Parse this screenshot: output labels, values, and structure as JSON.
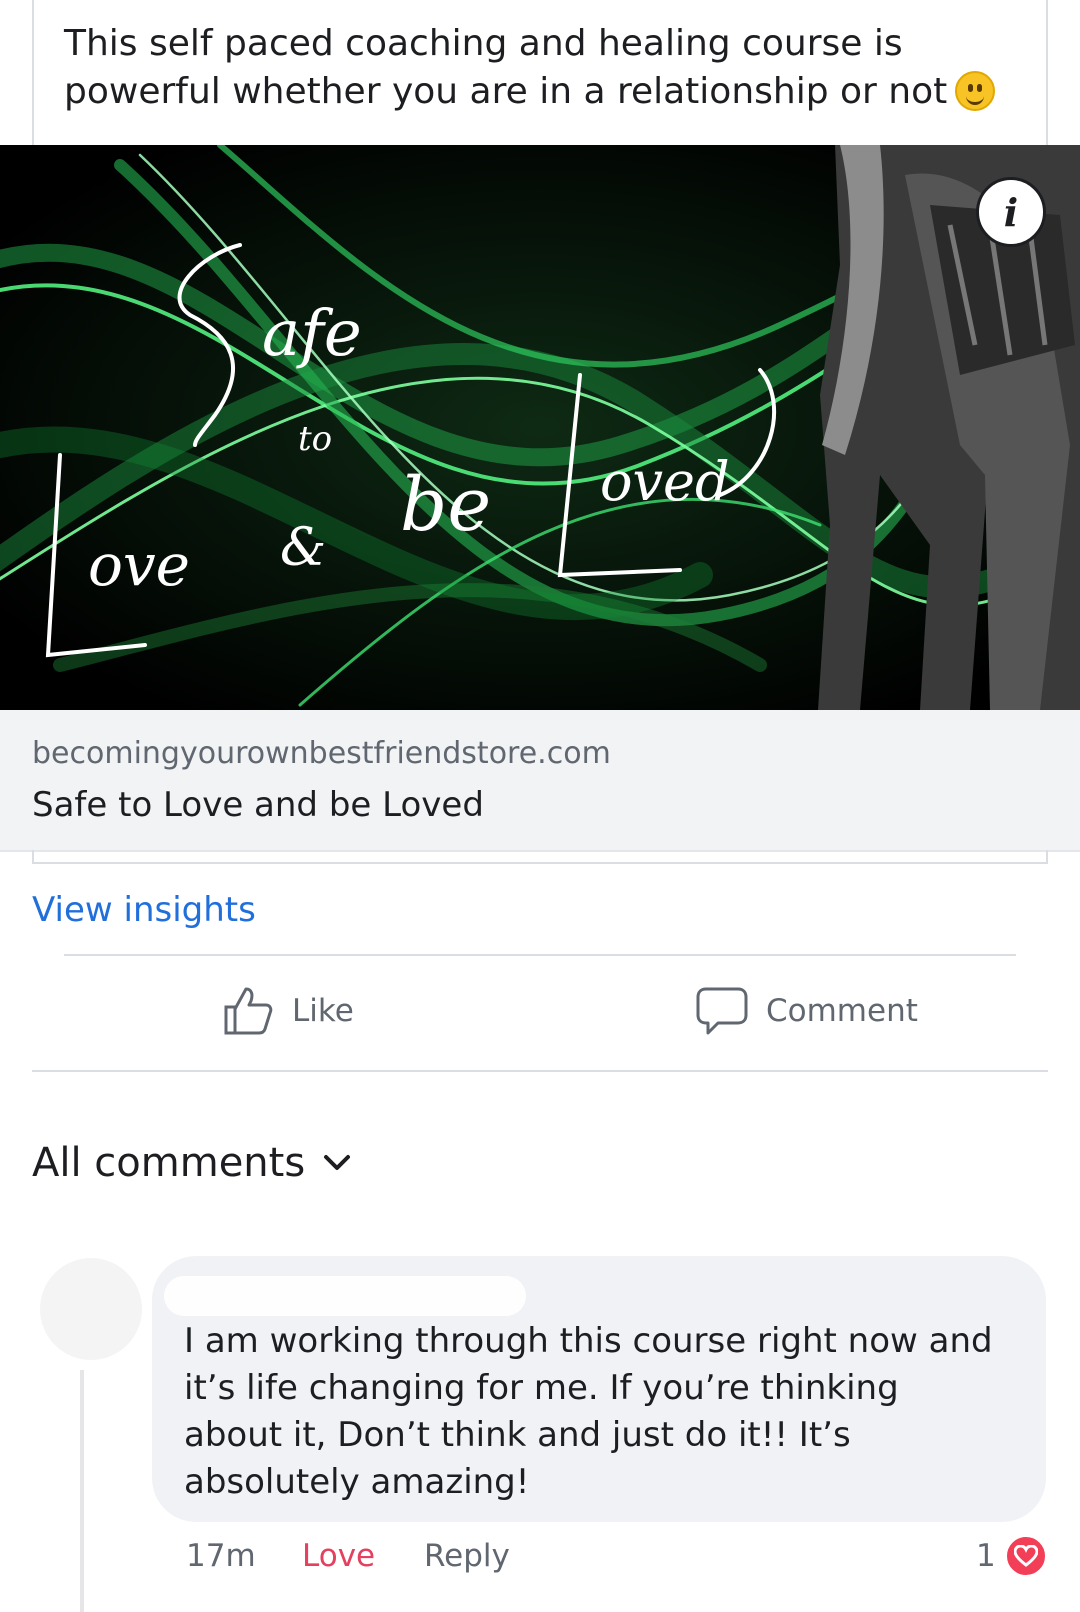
{
  "post": {
    "text": "This self paced coaching and healing course is powerful whether you are in a relationship or not",
    "emoji": "slightly-smiling-face"
  },
  "ad_image": {
    "script_words": [
      "Safe",
      "to",
      "Love",
      "&",
      "be",
      "Loved"
    ],
    "colors": {
      "background": "#000000",
      "accent": "#3ddc6a",
      "text": "#ffffff"
    },
    "info_label": "i"
  },
  "link_preview": {
    "domain": "becomingyourownbestfriendstore.com",
    "title": "Safe to Love and be Loved"
  },
  "insights": {
    "label": "View insights"
  },
  "actions": {
    "like": "Like",
    "comment": "Comment"
  },
  "comments_section": {
    "filter_label": "All comments",
    "comment": {
      "text": "I am working through this course right now and it’s life changing for me. If you’re thinking about it, Don’t think and just do it!! It’s absolutely amazing!",
      "time": "17m",
      "love_label": "Love",
      "reply_label": "Reply",
      "reaction_count": "1"
    }
  },
  "colors": {
    "link_blue": "#216fdb",
    "love_red": "#e4405f",
    "muted_text": "#606770",
    "bubble": "#f0f2f5"
  }
}
